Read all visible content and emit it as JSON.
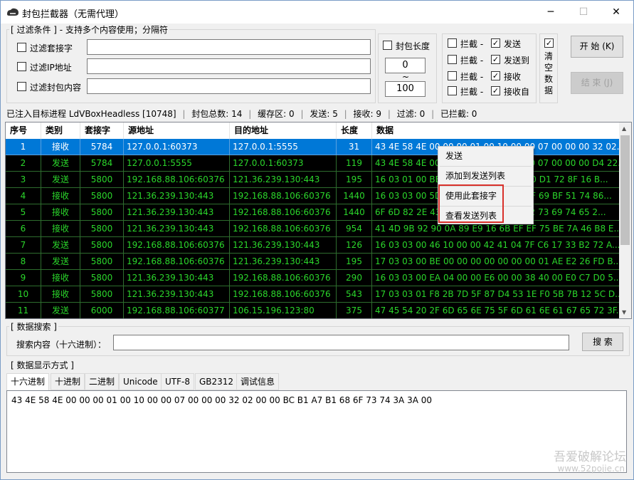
{
  "window": {
    "title": "封包拦截器（无需代理）",
    "minimize": "─",
    "maximize": "☐",
    "close": "✕"
  },
  "filter": {
    "group_title": "[ 过滤条件 ] - 支持多个内容使用；分隔符",
    "socket_label": "过滤套接字",
    "ip_label": "过滤IP地址",
    "content_label": "过滤封包内容",
    "socket_value": "",
    "ip_value": "",
    "content_value": ""
  },
  "length": {
    "label": "封包长度",
    "min": "0",
    "sep": "~",
    "max": "100"
  },
  "intercept": {
    "rows": [
      {
        "left_label": "拦截 -",
        "right_label": "发送",
        "right_checked": true
      },
      {
        "left_label": "拦截 -",
        "right_label": "发送到",
        "right_checked": true
      },
      {
        "left_label": "拦截 -",
        "right_label": "接收",
        "right_checked": true
      },
      {
        "left_label": "拦截 -",
        "right_label": "接收自",
        "right_checked": true
      }
    ],
    "check_mark": "✓"
  },
  "clear_data": {
    "label_1": "清",
    "label_2": "空",
    "label_3": "数",
    "label_4": "据",
    "checked": true
  },
  "buttons": {
    "start": "开 始 (K)",
    "stop": "结 束 (J)",
    "search": "搜 索"
  },
  "status": {
    "injected": "已注入目标进程 LdVBoxHeadless [10748]",
    "total": "封包总数: 14",
    "cache": "缓存区: 0",
    "sent": "发送: 5",
    "recv": "接收: 9",
    "filtered": "过滤: 0",
    "blocked": "已拦截: 0",
    "sep": "|"
  },
  "table": {
    "headers": [
      "序号",
      "类别",
      "套接字",
      "源地址",
      "目的地址",
      "长度",
      "数据"
    ],
    "rows": [
      [
        "1",
        "接收",
        "5784",
        "127.0.0.1:60373",
        "127.0.0.1:5555",
        "31",
        "43 4E 58 4E 00 00 00 01 00 10 00 00 07 00 00 00 32 02..."
      ],
      [
        "2",
        "发送",
        "5784",
        "127.0.0.1:5555",
        "127.0.0.1:60373",
        "119",
        "43 4E 58 4E 00 00 00 01 00 10 00 00 07 00 00 00 D4 22..."
      ],
      [
        "3",
        "发送",
        "5800",
        "192.168.88.106:60376",
        "121.36.239.130:443",
        "195",
        "16 03 01 00 BE 01 00 00 BA 03 03 60 D1 72 8F 16 B..."
      ],
      [
        "4",
        "接收",
        "5800",
        "121.36.239.130:443",
        "192.168.88.106:60376",
        "1440",
        "16 03 03 00 5D 02 00 00 59 03 03 3F 69 BF 51 74 86..."
      ],
      [
        "5",
        "接收",
        "5800",
        "121.36.239.130:443",
        "192.168.88.106:60376",
        "1440",
        "6F 6D 82 2E 43 69 73 63 6F 20 53 72 73 69 74 65 2..."
      ],
      [
        "6",
        "接收",
        "5800",
        "121.36.239.130:443",
        "192.168.88.106:60376",
        "954",
        "41 4D 9B 92 90 0A 89 E9 16 6B EF EF 75 BE 7A 46 B8 E..."
      ],
      [
        "7",
        "发送",
        "5800",
        "192.168.88.106:60376",
        "121.36.239.130:443",
        "126",
        "16 03 03 00 46 10 00 00 42 41 04 7F C6 17 33 B2 72 A..."
      ],
      [
        "8",
        "发送",
        "5800",
        "192.168.88.106:60376",
        "121.36.239.130:443",
        "195",
        "17 03 03 00 BE 00 00 00 00 00 00 00 01 AE E2 26 FD B..."
      ],
      [
        "9",
        "接收",
        "5800",
        "121.36.239.130:443",
        "192.168.88.106:60376",
        "290",
        "16 03 03 00 EA 04 00 00 E6 00 00 38 40 00 E0 C7 D0 5..."
      ],
      [
        "10",
        "接收",
        "5800",
        "121.36.239.130:443",
        "192.168.88.106:60376",
        "543",
        "17 03 03 01 F8 2B 7D 5F 87 D4 53 1E F0 5B 7B 12 5C D..."
      ],
      [
        "11",
        "发送",
        "6000",
        "192.168.88.106:60377",
        "106.15.196.123:80",
        "375",
        "47 45 54 20 2F 6D 65 6E 75 5F 6D 61 6E 61 67 65 72 3F..."
      ]
    ]
  },
  "context_menu": {
    "items": [
      "发送",
      "添加到发送列表",
      "使用此套接字",
      "查看发送列表"
    ]
  },
  "search": {
    "group_title": "[ 数据搜索 ]",
    "label": "搜索内容（十六进制）：",
    "value": ""
  },
  "display": {
    "group_title": "[ 数据显示方式 ]",
    "tabs": [
      "十六进制",
      "十进制",
      "二进制",
      "Unicode",
      "UTF-8",
      "GB2312",
      "调试信息"
    ],
    "output": "43 4E 58 4E 00 00 00 01 00 10 00 00 07 00 00 00 32 02 00 00 BC B1 A7 B1 68 6F 73 74 3A 3A 00"
  },
  "watermark": {
    "line1": "吾爱破解论坛",
    "line2": "www.52pojie.cn"
  }
}
